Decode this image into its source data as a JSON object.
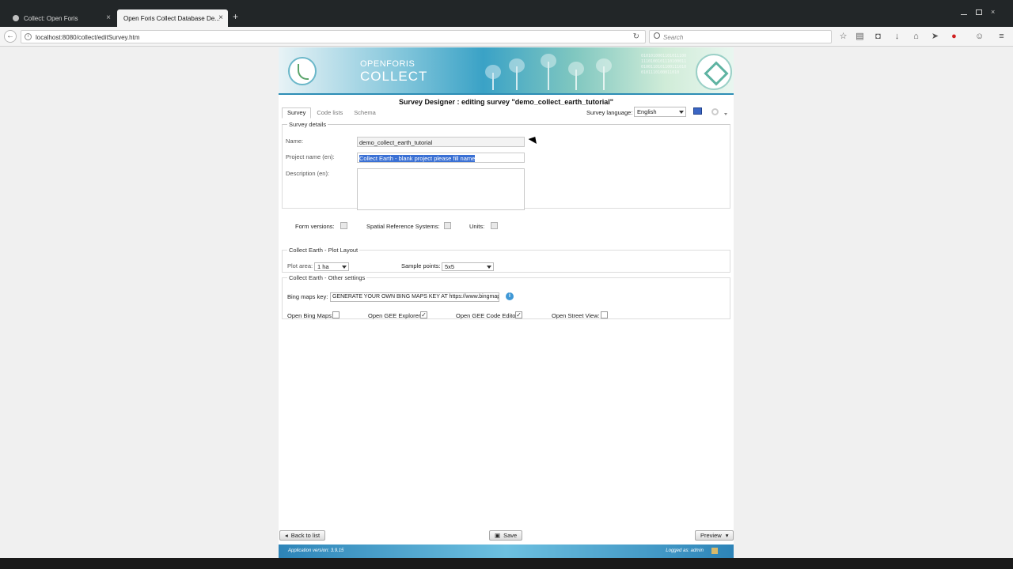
{
  "browser": {
    "tabs": [
      {
        "label": "Collect: Open Foris",
        "active": false
      },
      {
        "label": "Open Foris Collect Database De...",
        "active": true
      }
    ],
    "url": "localhost:8080/collect/editSurvey.htm",
    "search_placeholder": "Search"
  },
  "banner": {
    "brand_top": "OPENFORIS",
    "brand_main": "COLLECT",
    "binary": "0101010001101011100111010010111010001101001101011001110100101110100011010"
  },
  "page": {
    "title": "Survey Designer : editing survey \"demo_collect_earth_tutorial\"",
    "tabs": [
      "Survey",
      "Code lists",
      "Schema"
    ],
    "survey_language_label": "Survey language:",
    "survey_language_value": "English"
  },
  "survey_details": {
    "legend": "Survey details",
    "name_label": "Name:",
    "name_value": "demo_collect_earth_tutorial",
    "project_label": "Project name (en):",
    "project_value": "Collect Earth - blank project please fill name",
    "description_label": "Description (en):",
    "description_value": ""
  },
  "extras": {
    "form_versions": "Form versions:",
    "srs": "Spatial Reference Systems:",
    "units": "Units:"
  },
  "plot_layout": {
    "legend": "Collect Earth - Plot Layout",
    "plot_area_label": "Plot area:",
    "plot_area_value": "1 ha",
    "sample_points_label": "Sample points:",
    "sample_points_value": "5x5"
  },
  "other_settings": {
    "legend": "Collect Earth - Other settings",
    "bing_label": "Bing maps key:",
    "bing_value": "GENERATE YOUR OWN BING MAPS KEY AT https://www.bingmapsportal.com",
    "open_bing_label": "Open Bing Maps:",
    "open_bing_checked": false,
    "open_gee_explorer_label": "Open GEE Explorer:",
    "open_gee_explorer_checked": true,
    "open_gee_code_label": "Open GEE Code Editor:",
    "open_gee_code_checked": true,
    "open_street_label": "Open Street View:",
    "open_street_checked": false
  },
  "bottom": {
    "back_label": "Back to list",
    "save_label": "Save",
    "preview_label": "Preview"
  },
  "footer": {
    "version": "Application version: 3.9.15",
    "user": "Logged as: admin"
  }
}
